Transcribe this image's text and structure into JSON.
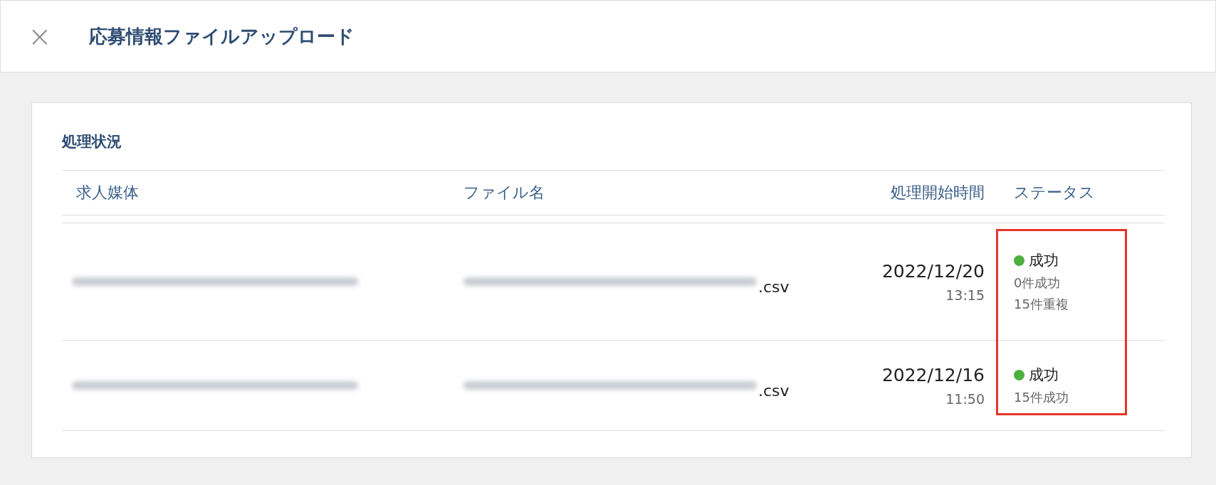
{
  "window": {
    "title": "応募情報ファイルアップロード",
    "close": "×"
  },
  "panel": {
    "title": "処理状況",
    "table": {
      "columns": [
        "求人媒体",
        "ファイル名",
        "処理開始時間",
        "ステータス"
      ],
      "highlight": true,
      "rows": [
        {
          "media_redacted": true,
          "file_redacted": true,
          "file_suffix": ".csv",
          "date": "2022/12/20",
          "time": "13:15",
          "status": {
            "label": "成功",
            "color": "#4caf3e",
            "details": [
              "0件成功",
              "15件重複"
            ]
          }
        },
        {
          "media_redacted": true,
          "file_redacted": true,
          "file_suffix": ".csv",
          "date": "2022/12/16",
          "time": "11:50",
          "status": {
            "label": "成功",
            "color": "#4caf3e",
            "details": [
              "15件成功"
            ]
          }
        }
      ]
    }
  }
}
